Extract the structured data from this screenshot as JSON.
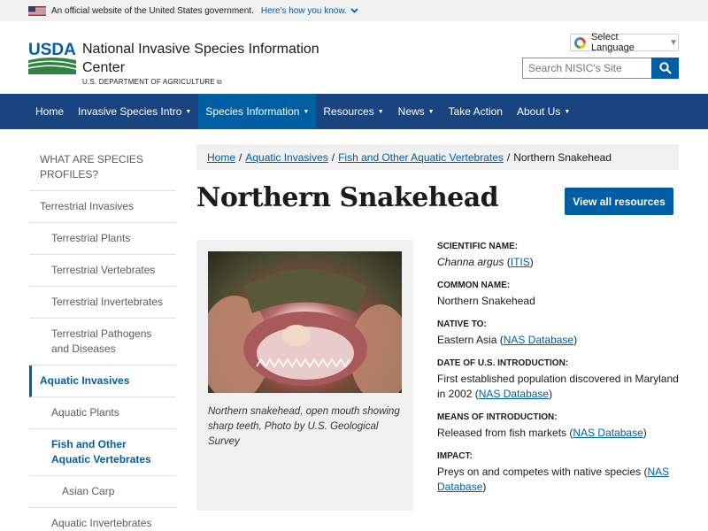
{
  "banner": {
    "text": "An official website of the United States government.",
    "link": "Here's how you know."
  },
  "header": {
    "title": "National Invasive Species Information Center",
    "subtitle": "U.S. DEPARTMENT OF AGRICULTURE",
    "language_label": "Select Language",
    "search_placeholder": "Search NISIC's Site"
  },
  "nav": {
    "items": [
      {
        "label": "Home",
        "dropdown": false
      },
      {
        "label": "Invasive Species Intro",
        "dropdown": true
      },
      {
        "label": "Species Information",
        "dropdown": true,
        "active": true
      },
      {
        "label": "Resources",
        "dropdown": true
      },
      {
        "label": "News",
        "dropdown": true
      },
      {
        "label": "Take Action",
        "dropdown": false
      },
      {
        "label": "About Us",
        "dropdown": true
      }
    ]
  },
  "sidebar": {
    "items": [
      {
        "label": "WHAT ARE SPECIES PROFILES?"
      },
      {
        "label": "Terrestrial Invasives"
      },
      {
        "label": "Terrestrial Plants"
      },
      {
        "label": "Terrestrial Vertebrates"
      },
      {
        "label": "Terrestrial Invertebrates"
      },
      {
        "label": "Terrestrial Pathogens and Diseases"
      },
      {
        "label": "Aquatic Invasives"
      },
      {
        "label": "Aquatic Plants"
      },
      {
        "label": "Fish and Other Aquatic Vertebrates"
      },
      {
        "label": "Asian Carp"
      },
      {
        "label": "Aquatic Invertebrates"
      }
    ]
  },
  "breadcrumb": {
    "items": [
      "Home",
      "Aquatic Invasives",
      "Fish and Other Aquatic Vertebrates"
    ],
    "current": "Northern Snakehead",
    "separator": "/"
  },
  "page": {
    "title": "Northern Snakehead",
    "view_all_label": "View all resources"
  },
  "figure": {
    "caption": "Northern snakehead, open mouth showing sharp teeth, Photo by U.S. Geological Survey"
  },
  "facts": {
    "scientific_name": {
      "label": "SCIENTIFIC NAME:",
      "value": "Channa argus",
      "link": "ITIS"
    },
    "common_name": {
      "label": "COMMON NAME:",
      "value": "Northern Snakehead"
    },
    "native_to": {
      "label": "NATIVE TO:",
      "value": "Eastern Asia",
      "link": "NAS Database"
    },
    "date_intro": {
      "label": "DATE OF U.S. INTRODUCTION:",
      "value": "First established population discovered in Maryland in 2002",
      "link": "NAS Database"
    },
    "means_intro": {
      "label": "MEANS OF INTRODUCTION:",
      "value": "Released from fish markets",
      "link": "NAS Database"
    },
    "impact": {
      "label": "IMPACT:",
      "value": "Preys on and competes with native species",
      "link": "NAS Database"
    }
  },
  "colors": {
    "nav_bg": "#1a4480",
    "accent": "#005ea2",
    "usda_green": "#2e8540"
  }
}
